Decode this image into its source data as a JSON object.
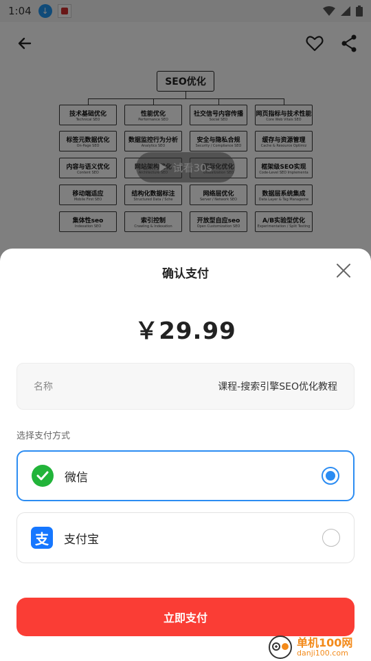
{
  "status_bar": {
    "time": "1:04"
  },
  "preview": {
    "trial_label": "试看30s",
    "mindmap": {
      "root": "SEO优化",
      "nodes": [
        {
          "cn": "技术基础优化",
          "en": "Technical SEO"
        },
        {
          "cn": "性能优化",
          "en": "Performance SEO"
        },
        {
          "cn": "社交信号内容传播",
          "en": "Social SEO"
        },
        {
          "cn": "网页指标与技术性能",
          "en": "Core Web Vitals SEO"
        },
        {
          "cn": "标签元数据优化",
          "en": "On-Page SEO"
        },
        {
          "cn": "数据监控行为分析",
          "en": "Analytics SEO"
        },
        {
          "cn": "安全与隐私合规",
          "en": "Security / Compliance SEO"
        },
        {
          "cn": "缓存与资源管理",
          "en": "Cache & Resource Optimiz"
        },
        {
          "cn": "内容与语义优化",
          "en": "Content SEO"
        },
        {
          "cn": "网站架构优化",
          "en": "Architecture SEO"
        },
        {
          "cn": "国际化优化",
          "en": "Globalization SEO"
        },
        {
          "cn": "框架级SEO实现",
          "en": "Code-Level SEO Implementa"
        },
        {
          "cn": "移动端适应",
          "en": "Mobile First SEO"
        },
        {
          "cn": "结构化数据标注",
          "en": "Structured Data / Sche"
        },
        {
          "cn": "网络层优化",
          "en": "Server / Network SEO"
        },
        {
          "cn": "数据层系统集成",
          "en": "Data Layer & Tag Manageme"
        },
        {
          "cn": "集体性seo",
          "en": "Indexation SEO"
        },
        {
          "cn": "索引控制",
          "en": "Crawling & Indexation"
        },
        {
          "cn": "开放型自应seo",
          "en": "Open Customization SEO"
        },
        {
          "cn": "A/B实验型优化",
          "en": "Experimentation / Split Testing"
        }
      ]
    }
  },
  "sheet": {
    "title": "确认支付",
    "price": "￥29.99",
    "name_label": "名称",
    "name_value": "课程-搜索引擎SEO优化教程",
    "choose_label": "选择支付方式",
    "options": [
      {
        "name": "微信",
        "selected": true,
        "icon": "wechat-pay-icon"
      },
      {
        "name": "支付宝",
        "selected": false,
        "icon": "alipay-icon"
      }
    ],
    "pay_button": "立即支付"
  },
  "watermark": {
    "line1": "单机100网",
    "line2": "danji100.com"
  },
  "colors": {
    "accent": "#2b8cf2",
    "pay_button": "#fa3d35",
    "wechat": "#22b43a",
    "alipay": "#1677ff"
  }
}
